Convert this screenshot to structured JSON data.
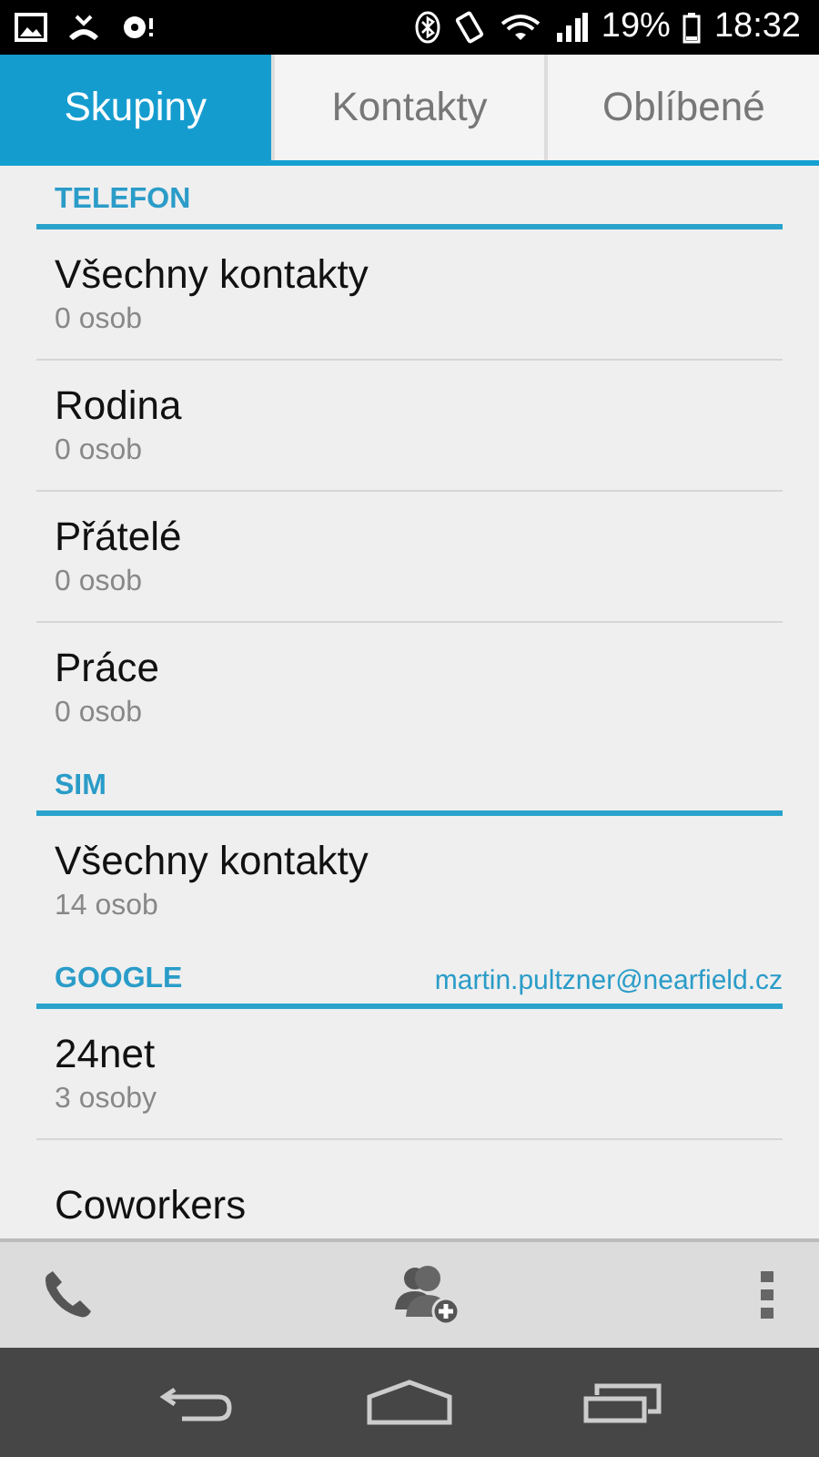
{
  "status_bar": {
    "battery": "19%",
    "time": "18:32"
  },
  "tabs": [
    {
      "label": "Skupiny",
      "selected": true
    },
    {
      "label": "Kontakty",
      "selected": false
    },
    {
      "label": "Oblíbené",
      "selected": false
    }
  ],
  "sections": [
    {
      "title": "TELEFON",
      "groups": [
        {
          "name": "Všechny kontakty",
          "count": "0 osob"
        },
        {
          "name": "Rodina",
          "count": "0 osob"
        },
        {
          "name": "Přátelé",
          "count": "0 osob"
        },
        {
          "name": "Práce",
          "count": "0 osob"
        }
      ]
    },
    {
      "title": "SIM",
      "groups": [
        {
          "name": "Všechny kontakty",
          "count": "14 osob"
        }
      ]
    },
    {
      "title": "GOOGLE",
      "account": "martin.pultzner@nearfield.cz",
      "groups": [
        {
          "name": "24net",
          "count": "3 osoby"
        },
        {
          "name": "Coworkers"
        }
      ]
    }
  ]
}
